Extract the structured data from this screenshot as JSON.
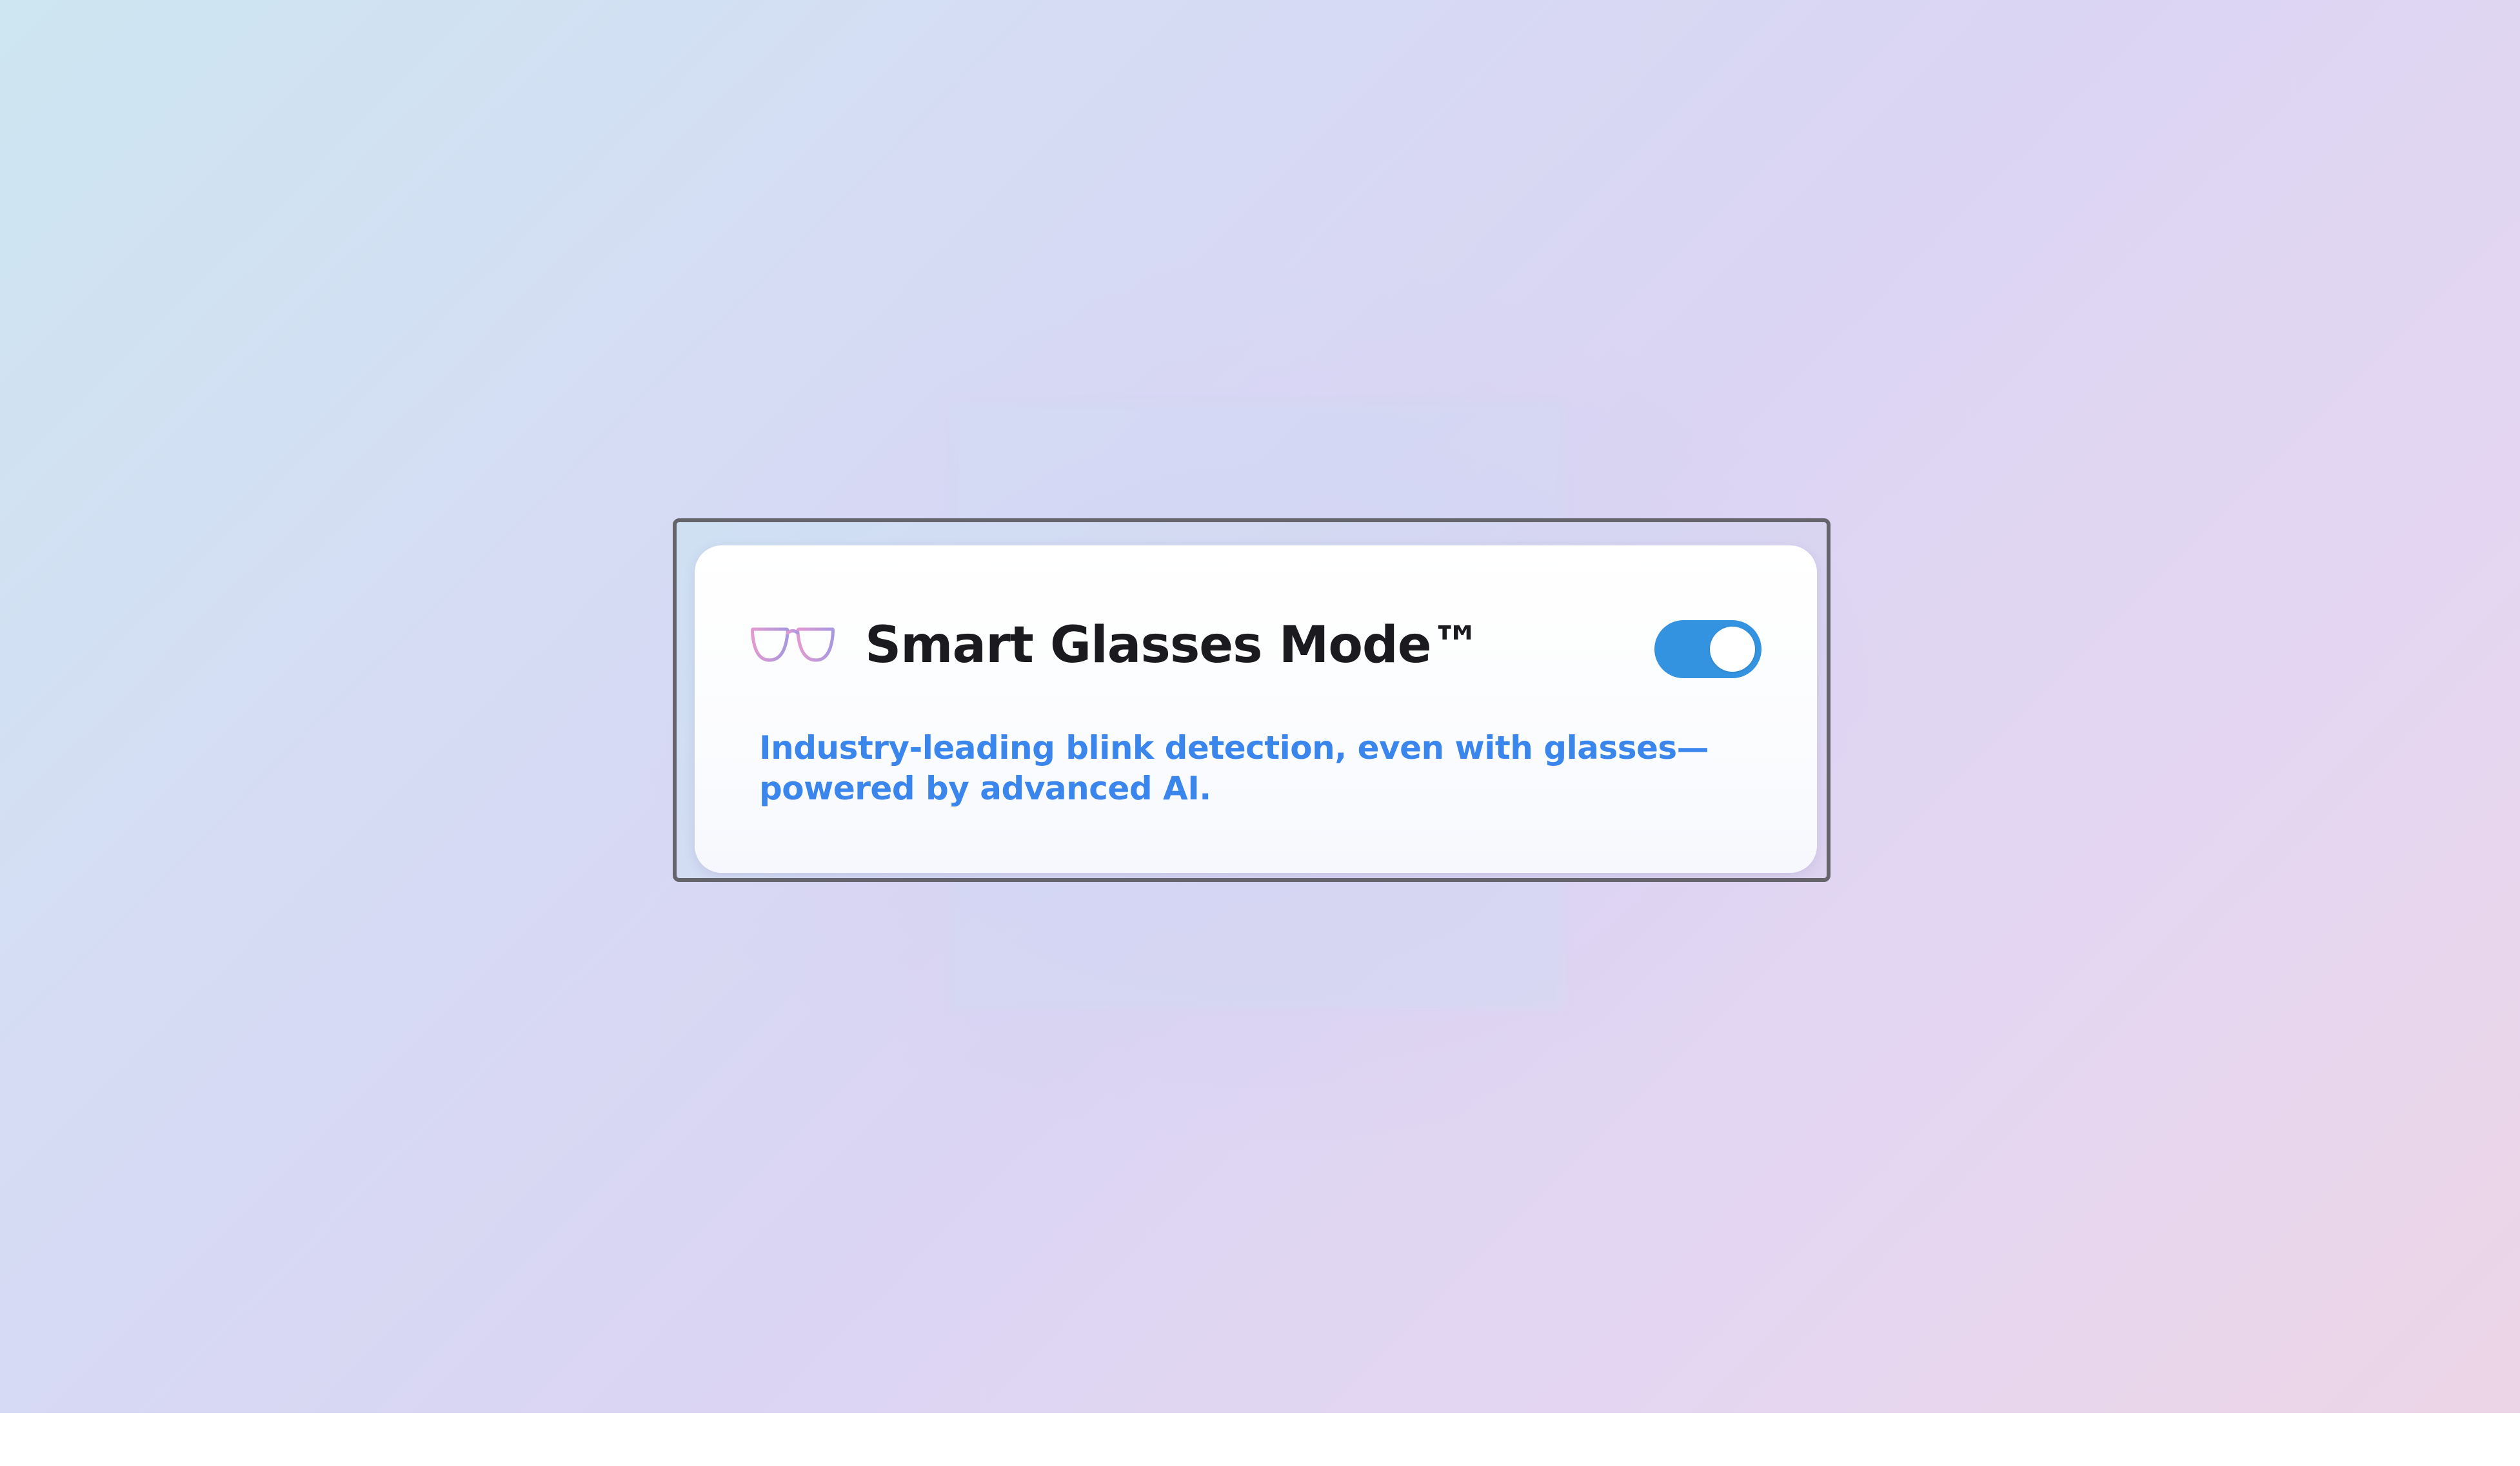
{
  "feature_card": {
    "icon": "glasses-icon",
    "title": "Smart Glasses Mode™",
    "toggle": {
      "state": "on",
      "accent_color": "#3393e0"
    },
    "description_lines": [
      "Industry-leading blink detection, even with glasses—",
      "powered by advanced AI."
    ],
    "description_color": "#3a86ec"
  }
}
